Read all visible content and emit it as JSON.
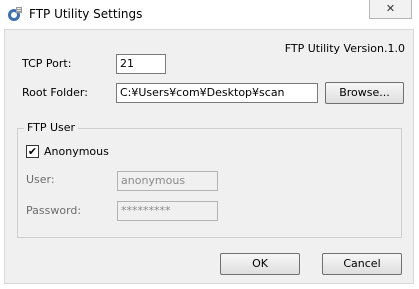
{
  "window": {
    "title": "FTP Utility Settings",
    "close_glyph": "✕"
  },
  "version_text": "FTP Utility Version.1.0",
  "tcp_port": {
    "label": "TCP Port:",
    "value": "21"
  },
  "root_folder": {
    "label": "Root Folder:",
    "value": "C:¥Users¥com¥Desktop¥scan",
    "browse_label": "Browse..."
  },
  "ftp_user": {
    "group_label": "FTP User",
    "anonymous": {
      "label": "Anonymous",
      "checked": true,
      "check_glyph": "✔"
    },
    "user": {
      "label": "User:",
      "value": "anonymous"
    },
    "password": {
      "label": "Password:",
      "value": "*********"
    }
  },
  "buttons": {
    "ok_label": "OK",
    "cancel_label": "Cancel"
  },
  "colors": {
    "dialog_bg": "#f0f0f0",
    "title_bg": "#ffffff",
    "icon_blue": "#3a6fb6",
    "icon_gray": "#9b9b9b"
  }
}
